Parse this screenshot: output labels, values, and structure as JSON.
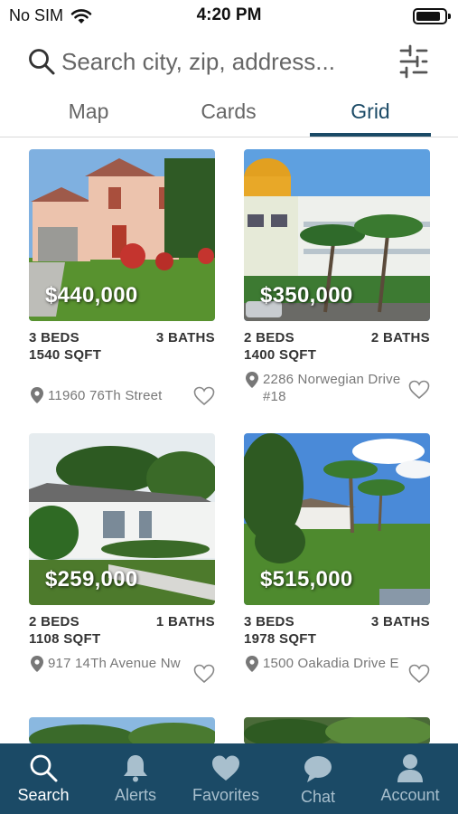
{
  "status_bar": {
    "carrier": "No SIM",
    "time": "4:20 PM"
  },
  "search": {
    "placeholder": "Search city, zip, address...",
    "icon": "search-icon",
    "filter_icon": "sliders-icon"
  },
  "tabs": [
    {
      "label": "Map",
      "active": false
    },
    {
      "label": "Cards",
      "active": false
    },
    {
      "label": "Grid",
      "active": true
    }
  ],
  "listings": [
    {
      "price": "$440,000",
      "beds": "3 BEDS",
      "baths": "3 BATHS",
      "sqft": "1540 SQFT",
      "address": "11960 76Th Street"
    },
    {
      "price": "$350,000",
      "beds": "2 BEDS",
      "baths": "2 BATHS",
      "sqft": "1400 SQFT",
      "address": "2286 Norwegian Drive #18"
    },
    {
      "price": "$259,000",
      "beds": "2 BEDS",
      "baths": "1 BATHS",
      "sqft": "1108 SQFT",
      "address": "917 14Th Avenue Nw"
    },
    {
      "price": "$515,000",
      "beds": "3 BEDS",
      "baths": "3 BATHS",
      "sqft": "1978 SQFT",
      "address": "1500 Oakadia Drive E"
    }
  ],
  "bottom_nav": [
    {
      "label": "Search",
      "icon": "search-icon",
      "active": true
    },
    {
      "label": "Alerts",
      "icon": "bell-icon",
      "active": false
    },
    {
      "label": "Favorites",
      "icon": "heart-icon",
      "active": false
    },
    {
      "label": "Chat",
      "icon": "chat-bubble-icon",
      "active": false
    },
    {
      "label": "Account",
      "icon": "person-icon",
      "active": false
    }
  ],
  "colors": {
    "brand": "#1b4a66",
    "nav_inactive": "#a8bfcd"
  }
}
